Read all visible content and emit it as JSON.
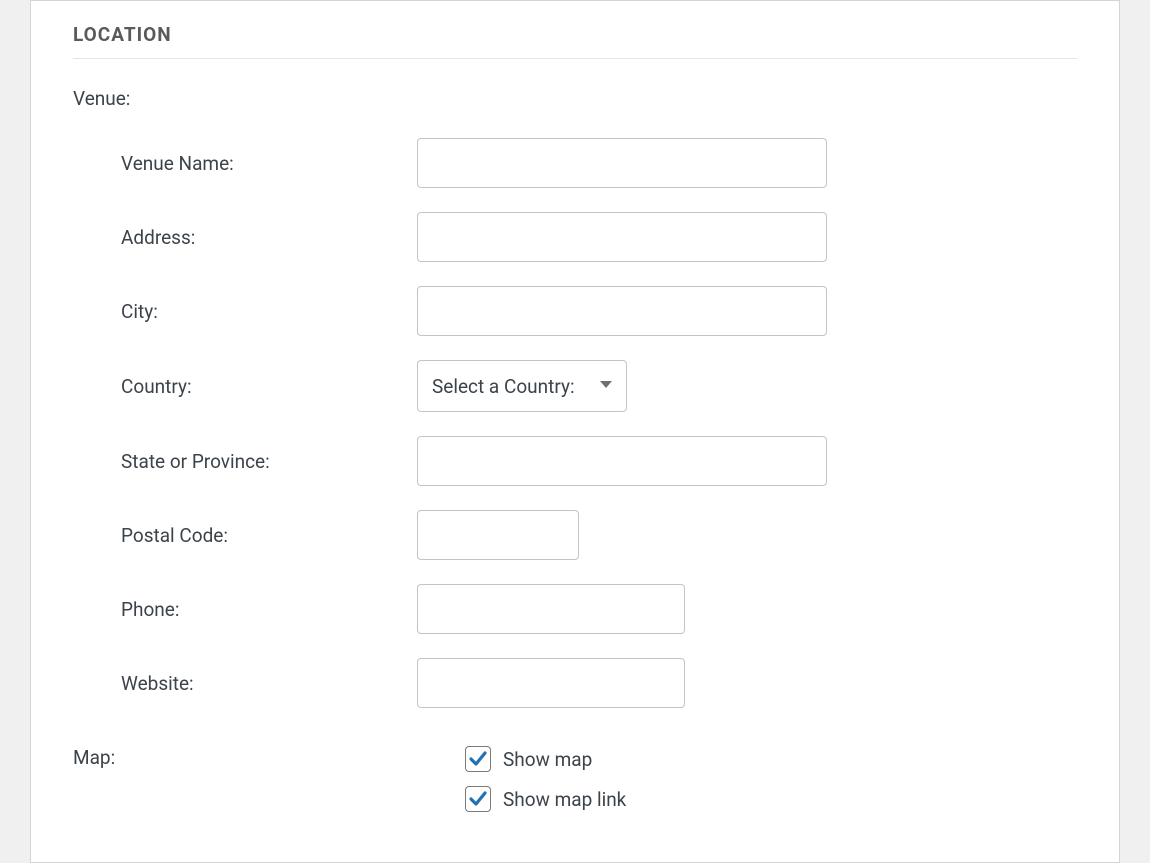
{
  "section": {
    "title": "LOCATION"
  },
  "venue": {
    "group_label": "Venue:",
    "fields": {
      "name": {
        "label": "Venue Name:",
        "value": ""
      },
      "address": {
        "label": "Address:",
        "value": ""
      },
      "city": {
        "label": "City:",
        "value": ""
      },
      "country": {
        "label": "Country:",
        "selected": "Select a Country:"
      },
      "state": {
        "label": "State or Province:",
        "value": ""
      },
      "postal": {
        "label": "Postal Code:",
        "value": ""
      },
      "phone": {
        "label": "Phone:",
        "value": ""
      },
      "website": {
        "label": "Website:",
        "value": ""
      }
    }
  },
  "map": {
    "label": "Map:",
    "show_map": {
      "label": "Show map",
      "checked": true
    },
    "show_map_link": {
      "label": "Show map link",
      "checked": true
    }
  }
}
